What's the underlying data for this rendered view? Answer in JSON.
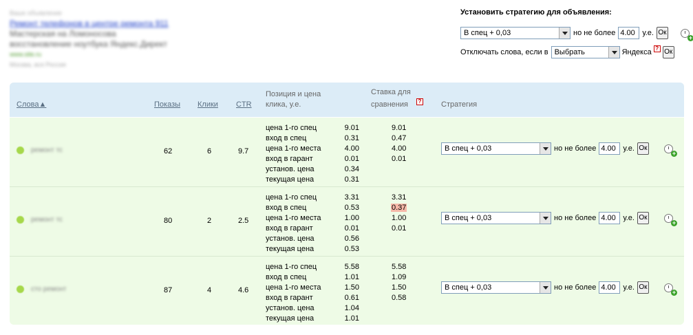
{
  "ad": {
    "label": "Ваше объявление",
    "title": "Ремонт телефонов в центре ремонта 911",
    "text_line1": "Мастерская на Ломоносова",
    "text_line2": "восстановление ноутбука Яндекс.Директ",
    "url": "www.site.ru",
    "region": "Москва, вся Россия"
  },
  "top_panel": {
    "title": "Установить стратегию для объявления:",
    "strategy_value": "В спец + 0,03",
    "no_more_label": "но не более",
    "amount_value": "4.00",
    "unit_label": "у.е.",
    "ok_label": "Ок",
    "disable_label": "Отключать слова, если в",
    "disable_select_value": "Выбрать",
    "yandex_label": "Яндекса",
    "help_glyph": "?"
  },
  "table": {
    "headers": {
      "words": "Слова▲",
      "shows": "Показы",
      "clicks": "Клики",
      "ctr": "CTR",
      "position_line1": "Позиция и цена",
      "position_line2": "клика, у.е.",
      "bid_line1": "Ставка для",
      "bid_line2": "сравнения",
      "strategy": "Стратегия"
    },
    "position_labels": [
      "цена 1-го спец",
      "вход в спец",
      "цена 1-го места",
      "вход в гарант",
      "установ. цена",
      "текущая цена"
    ],
    "rows": [
      {
        "word": "ремонт тс",
        "shows": "62",
        "clicks": "6",
        "ctr": "9.7",
        "position_values": [
          "9.01",
          "0.31",
          "4.00",
          "0.01",
          "0.34",
          "0.31"
        ],
        "bids": [
          "9.01",
          "0.47",
          "4.00",
          "0.01"
        ],
        "highlight_index": -1,
        "strategy_value": "В спец + 0,03",
        "amount_value": "4.00"
      },
      {
        "word": "ремонт тс",
        "shows": "80",
        "clicks": "2",
        "ctr": "2.5",
        "position_values": [
          "3.31",
          "0.53",
          "1.00",
          "0.01",
          "0.56",
          "0.53"
        ],
        "bids": [
          "3.31",
          "0.37",
          "1.00",
          "0.01"
        ],
        "highlight_index": 1,
        "strategy_value": "В спец + 0,03",
        "amount_value": "4.00"
      },
      {
        "word": "сто ремонт",
        "shows": "87",
        "clicks": "4",
        "ctr": "4.6",
        "position_values": [
          "5.58",
          "1.01",
          "1.50",
          "0.61",
          "1.04",
          "1.01"
        ],
        "bids": [
          "5.58",
          "1.09",
          "1.50",
          "0.58"
        ],
        "highlight_index": -1,
        "strategy_value": "В спец + 0,03",
        "amount_value": "4.00"
      }
    ]
  },
  "icons": {
    "clock": "add-schedule-clock-icon",
    "help": "help-icon",
    "keyword": "keyword-status-icon"
  },
  "colors": {
    "header_bg": "#dcecf7",
    "table_bg": "#eefbe6",
    "highlight": "#f6b8a8",
    "link": "#5a6f83"
  }
}
